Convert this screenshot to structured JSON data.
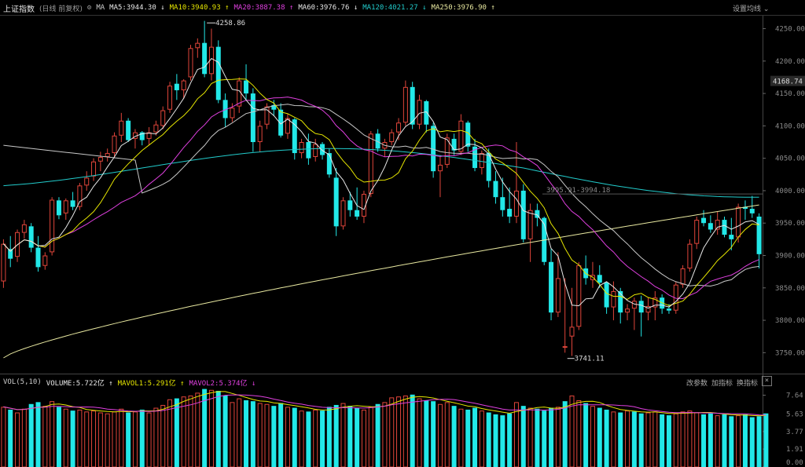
{
  "header": {
    "index_name": "上证指数",
    "period_info": "(日线 前复权)",
    "ma_prefix": "MA",
    "indicators": [
      {
        "label": "MA5:3944.30",
        "arrow": "↓",
        "color": "#e8e8e8"
      },
      {
        "label": "MA10:3940.93",
        "arrow": "↑",
        "color": "#e6e600"
      },
      {
        "label": "MA20:3887.38",
        "arrow": "↑",
        "color": "#e040e0"
      },
      {
        "label": "MA60:3976.76",
        "arrow": "↓",
        "color": "#e8e8e8"
      },
      {
        "label": "MA120:4021.27",
        "arrow": "↓",
        "color": "#22cccc"
      },
      {
        "label": "MA250:3976.90",
        "arrow": "↑",
        "color": "#e8e8a0"
      }
    ],
    "settings_label": "设置均线",
    "settings_icon": "gear-icon"
  },
  "volume_header": {
    "label": "VOL(5,10)",
    "items": [
      {
        "label": "VOLUME:5.722亿",
        "arrow": "↑",
        "color": "#e8e8e8"
      },
      {
        "label": "MAVOL1:5.291亿",
        "arrow": "↑",
        "color": "#e6e600"
      },
      {
        "label": "MAVOL2:5.374亿",
        "arrow": "↓",
        "color": "#e040e0"
      }
    ],
    "buttons": [
      "改参数",
      "加指标",
      "换指标"
    ],
    "close_label": "×"
  },
  "price_axis": {
    "ticks": [
      "4250.00",
      "4200.00",
      "4150.00",
      "4100.00",
      "4050.00",
      "4000.00",
      "3950.00",
      "3900.00",
      "3850.00",
      "3800.00",
      "3750.00"
    ],
    "current_price": "4168.74"
  },
  "volume_axis": {
    "ticks": [
      "7.64",
      "5.63",
      "3.77",
      "1.91",
      "0.00"
    ]
  },
  "annotations": {
    "high": "4258.86",
    "low": "3741.11",
    "crosshair": "3995.91-3994.18"
  },
  "colors": {
    "up": "#e0453a",
    "down": "#22e8e8",
    "ma5": "#e8e8e8",
    "ma10": "#e6e600",
    "ma20": "#e040e0",
    "ma60": "#c8c8c8",
    "ma120": "#22cccc",
    "ma250": "#e8e8a0"
  },
  "chart_data": {
    "type": "candlestick",
    "y_range": [
      3725,
      4270
    ],
    "volume_range": [
      0,
      8.6
    ],
    "candles": [
      [
        3860,
        3925,
        3850,
        3918
      ],
      [
        3910,
        3930,
        3882,
        3895
      ],
      [
        3898,
        3940,
        3890,
        3936
      ],
      [
        3935,
        3955,
        3926,
        3948
      ],
      [
        3945,
        3950,
        3905,
        3912
      ],
      [
        3912,
        3930,
        3875,
        3882
      ],
      [
        3884,
        3905,
        3878,
        3900
      ],
      [
        3905,
        3990,
        3900,
        3986
      ],
      [
        3985,
        3990,
        3956,
        3962
      ],
      [
        3965,
        3988,
        3955,
        3985
      ],
      [
        3985,
        3998,
        3970,
        3975
      ],
      [
        3975,
        4012,
        3970,
        4008
      ],
      [
        4008,
        4030,
        4000,
        4020
      ],
      [
        4022,
        4050,
        4015,
        4045
      ],
      [
        4045,
        4060,
        4030,
        4052
      ],
      [
        4052,
        4065,
        4045,
        4058
      ],
      [
        4058,
        4090,
        4050,
        4085
      ],
      [
        4085,
        4120,
        4075,
        4108
      ],
      [
        4108,
        4112,
        4075,
        4078
      ],
      [
        4080,
        4095,
        4065,
        4090
      ],
      [
        4090,
        4092,
        4070,
        4078
      ],
      [
        4080,
        4098,
        4070,
        4090
      ],
      [
        4090,
        4108,
        4085,
        4102
      ],
      [
        4100,
        4130,
        4095,
        4124
      ],
      [
        4125,
        4168,
        4120,
        4162
      ],
      [
        4165,
        4180,
        4140,
        4155
      ],
      [
        4155,
        4172,
        4142,
        4170
      ],
      [
        4175,
        4225,
        4170,
        4220
      ],
      [
        4220,
        4235,
        4205,
        4228
      ],
      [
        4228,
        4262,
        4175,
        4180
      ],
      [
        4180,
        4250,
        4170,
        4222
      ],
      [
        4222,
        4232,
        4135,
        4140
      ],
      [
        4140,
        4150,
        4098,
        4112
      ],
      [
        4112,
        4135,
        4106,
        4128
      ],
      [
        4130,
        4175,
        4120,
        4170
      ],
      [
        4170,
        4195,
        4140,
        4150
      ],
      [
        4150,
        4158,
        4060,
        4075
      ],
      [
        4075,
        4108,
        4060,
        4100
      ],
      [
        4102,
        4135,
        4095,
        4130
      ],
      [
        4132,
        4140,
        4115,
        4125
      ],
      [
        4125,
        4135,
        4082,
        4085
      ],
      [
        4088,
        4118,
        4080,
        4112
      ],
      [
        4110,
        4112,
        4048,
        4058
      ],
      [
        4058,
        4080,
        4050,
        4075
      ],
      [
        4075,
        4088,
        4040,
        4050
      ],
      [
        4052,
        4080,
        4045,
        4072
      ],
      [
        4072,
        4075,
        4048,
        4055
      ],
      [
        4058,
        4065,
        4020,
        4025
      ],
      [
        4020,
        4035,
        3930,
        3945
      ],
      [
        3945,
        3990,
        3940,
        3985
      ],
      [
        3985,
        3998,
        3960,
        3970
      ],
      [
        3970,
        4005,
        3955,
        3960
      ],
      [
        3960,
        4000,
        3950,
        3995
      ],
      [
        3995,
        4092,
        3990,
        4088
      ],
      [
        4088,
        4095,
        4060,
        4065
      ],
      [
        4065,
        4080,
        4052,
        4075
      ],
      [
        4075,
        4095,
        4070,
        4090
      ],
      [
        4090,
        4112,
        4078,
        4105
      ],
      [
        4105,
        4170,
        4100,
        4160
      ],
      [
        4160,
        4168,
        4095,
        4102
      ],
      [
        4102,
        4148,
        4095,
        4140
      ],
      [
        4138,
        4140,
        4090,
        4102
      ],
      [
        4100,
        4105,
        4020,
        4030
      ],
      [
        4030,
        4055,
        3990,
        4040
      ],
      [
        4040,
        4088,
        4035,
        4082
      ],
      [
        4080,
        4088,
        4055,
        4062
      ],
      [
        4060,
        4118,
        4055,
        4108
      ],
      [
        4105,
        4108,
        4060,
        4068
      ],
      [
        4068,
        4080,
        4030,
        4035
      ],
      [
        4035,
        4062,
        4025,
        4058
      ],
      [
        4058,
        4065,
        4005,
        4015
      ],
      [
        4015,
        4030,
        3980,
        3990
      ],
      [
        3990,
        4020,
        3960,
        3970
      ],
      [
        3972,
        4005,
        3950,
        3960
      ],
      [
        3960,
        4075,
        3950,
        4000
      ],
      [
        4000,
        4010,
        3920,
        3925
      ],
      [
        3925,
        3980,
        3890,
        3970
      ],
      [
        3970,
        3980,
        3945,
        3958
      ],
      [
        3958,
        3960,
        3885,
        3890
      ],
      [
        3890,
        3910,
        3800,
        3812
      ],
      [
        3812,
        3905,
        3805,
        3865
      ],
      [
        3760,
        3865,
        3750,
        3760
      ],
      [
        3775,
        3850,
        3745,
        3790
      ],
      [
        3790,
        3890,
        3785,
        3885
      ],
      [
        3880,
        3900,
        3855,
        3865
      ],
      [
        3862,
        3890,
        3850,
        3870
      ],
      [
        3870,
        3885,
        3850,
        3858
      ],
      [
        3858,
        3860,
        3810,
        3820
      ],
      [
        3820,
        3860,
        3800,
        3845
      ],
      [
        3845,
        3850,
        3795,
        3812
      ],
      [
        3812,
        3825,
        3800,
        3818
      ],
      [
        3818,
        3835,
        3785,
        3830
      ],
      [
        3830,
        3838,
        3775,
        3812
      ],
      [
        3812,
        3835,
        3800,
        3822
      ],
      [
        3820,
        3845,
        3800,
        3835
      ],
      [
        3835,
        3840,
        3810,
        3818
      ],
      [
        3818,
        3825,
        3810,
        3815
      ],
      [
        3815,
        3860,
        3810,
        3855
      ],
      [
        3855,
        3885,
        3850,
        3880
      ],
      [
        3880,
        3925,
        3875,
        3918
      ],
      [
        3918,
        3960,
        3910,
        3955
      ],
      [
        3958,
        3970,
        3945,
        3950
      ],
      [
        3950,
        3962,
        3935,
        3940
      ],
      [
        3940,
        3968,
        3932,
        3955
      ],
      [
        3955,
        3960,
        3928,
        3932
      ],
      [
        3932,
        3958,
        3908,
        3925
      ],
      [
        3928,
        3980,
        3920,
        3975
      ],
      [
        3975,
        3985,
        3955,
        3972
      ],
      [
        3972,
        3992,
        3958,
        3965
      ],
      [
        3960,
        3965,
        3880,
        3902
      ]
    ],
    "volumes": [
      6.4,
      6.1,
      5.8,
      6.2,
      6.7,
      6.9,
      6.5,
      7.0,
      6.4,
      6.2,
      6.0,
      6.1,
      5.9,
      6.0,
      5.8,
      5.7,
      5.9,
      6.2,
      5.8,
      5.9,
      6.1,
      5.8,
      6.3,
      6.6,
      7.2,
      7.3,
      7.5,
      7.6,
      7.9,
      8.3,
      8.2,
      8.1,
      7.6,
      6.9,
      7.3,
      7.1,
      7.0,
      6.8,
      6.7,
      6.5,
      6.8,
      6.4,
      6.3,
      6.0,
      5.9,
      6.1,
      6.0,
      6.4,
      6.6,
      6.8,
      6.5,
      6.3,
      6.1,
      6.4,
      6.7,
      6.9,
      7.4,
      7.5,
      7.6,
      7.7,
      7.3,
      7.1,
      7.0,
      6.7,
      6.9,
      6.5,
      6.2,
      6.1,
      6.3,
      6.0,
      5.8,
      5.6,
      5.5,
      5.7,
      6.9,
      6.5,
      6.3,
      6.2,
      6.0,
      6.3,
      6.4,
      7.0,
      7.6,
      7.1,
      6.8,
      6.5,
      6.3,
      6.1,
      5.9,
      5.8,
      6.0,
      5.9,
      5.7,
      5.8,
      5.9,
      5.6,
      5.5,
      5.7,
      5.9,
      6.0,
      5.8,
      5.6,
      5.7,
      5.5,
      5.6,
      5.4,
      5.5,
      5.6,
      5.3,
      5.4,
      5.7
    ],
    "volume_up": [
      true,
      false,
      true,
      true,
      false,
      false,
      true,
      true,
      false,
      true,
      false,
      true,
      true,
      true,
      true,
      true,
      true,
      true,
      false,
      true,
      false,
      true,
      true,
      true,
      true,
      false,
      true,
      true,
      true,
      false,
      true,
      false,
      false,
      true,
      true,
      false,
      false,
      true,
      true,
      false,
      false,
      true,
      false,
      true,
      false,
      true,
      false,
      false,
      false,
      true,
      false,
      false,
      true,
      true,
      false,
      true,
      true,
      true,
      true,
      false,
      true,
      false,
      false,
      true,
      true,
      false,
      true,
      false,
      false,
      true,
      false,
      false,
      false,
      false,
      true,
      false,
      true,
      false,
      false,
      false,
      true,
      false,
      true,
      true,
      false,
      true,
      false,
      false,
      true,
      false,
      true,
      false,
      false,
      true,
      true,
      false,
      false,
      true,
      true,
      true,
      true,
      false,
      false,
      true,
      false,
      false,
      true,
      false,
      false,
      false
    ]
  }
}
